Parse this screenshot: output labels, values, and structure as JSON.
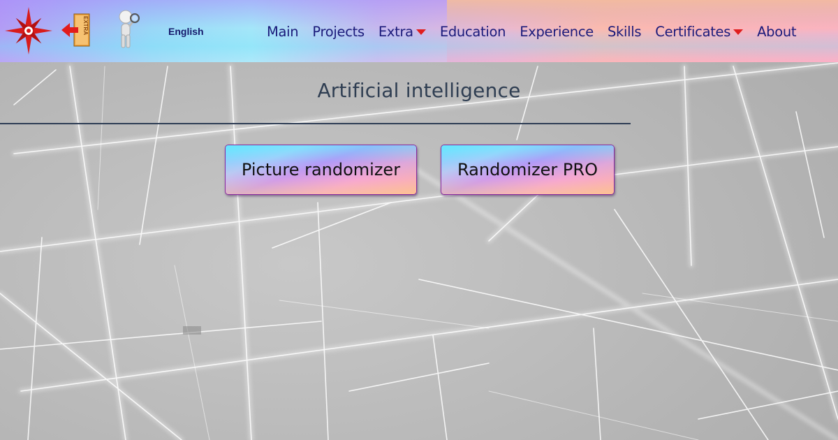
{
  "header": {
    "language_label": "English",
    "nav": [
      {
        "label": "Main",
        "has_dropdown": false
      },
      {
        "label": "Projects",
        "has_dropdown": false
      },
      {
        "label": "Extra",
        "has_dropdown": true
      },
      {
        "label": "Education",
        "has_dropdown": false
      },
      {
        "label": "Experience",
        "has_dropdown": false
      },
      {
        "label": "Skills",
        "has_dropdown": false
      },
      {
        "label": "Certificates",
        "has_dropdown": true
      },
      {
        "label": "About",
        "has_dropdown": false
      }
    ],
    "extra_badge_text": "EXTRA",
    "icons": [
      "compass-star-logo-icon",
      "extra-exit-door-icon",
      "search-figure-icon",
      "dropdown-caret-icon"
    ]
  },
  "main": {
    "title": "Artificial intelligence",
    "buttons": [
      {
        "label": "Picture randomizer"
      },
      {
        "label": "Randomizer PRO"
      }
    ]
  },
  "colors": {
    "nav_text": "#1a1a7a",
    "caret": "#e01e1e",
    "title_text": "#2f3e52",
    "button_border": "#8a2aa0",
    "background": "#b9b9b9"
  }
}
